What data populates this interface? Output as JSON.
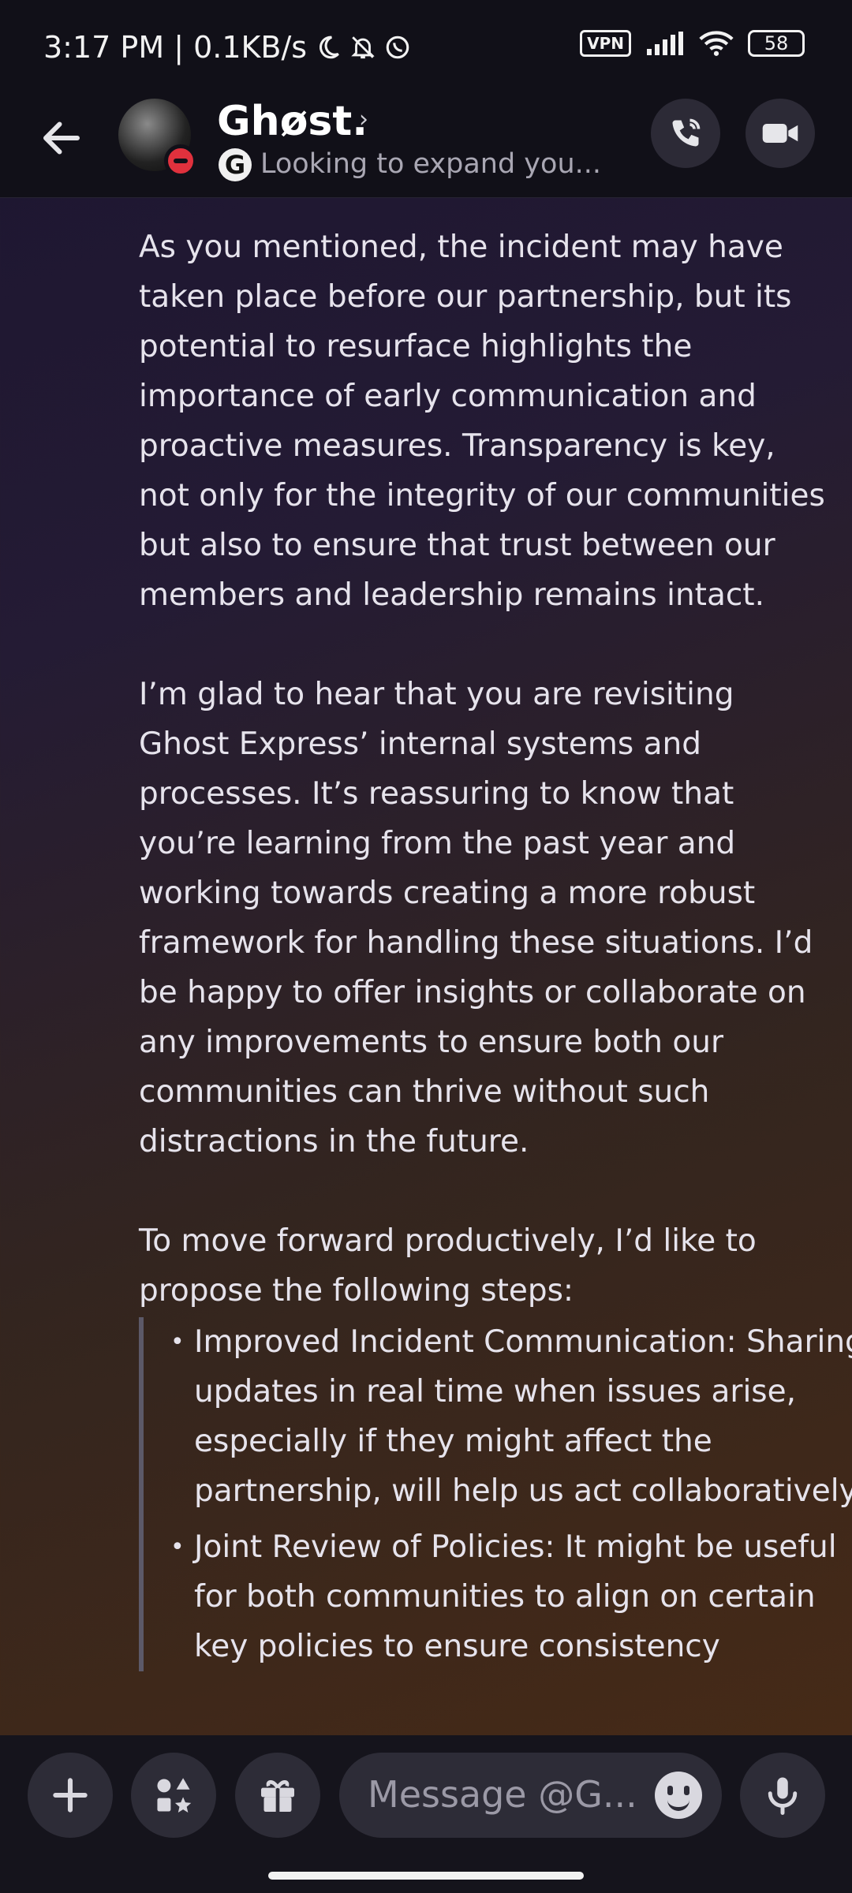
{
  "status_bar": {
    "time_net": "3:17 PM | 0.1KB/s",
    "vpn_label": "VPN",
    "battery": "58"
  },
  "header": {
    "name": "Ghøst.",
    "chevron": "›",
    "subtitle_icon": "G",
    "status_text": "Looking to expand you..."
  },
  "message": {
    "paragraphs": [
      "As you mentioned, the incident may have taken place before our partnership, but its potential to resurface highlights the importance of early communication and proactive measures. Transparency is key, not only for the integrity of our communities but also to ensure that trust between our members and leadership remains intact.",
      "I’m glad to hear that you are revisiting Ghost Express’ internal systems and processes. It’s reassuring to know that you’re learning from the past year and working towards creating a more robust framework for handling these situations. I’d be happy to offer insights or collaborate on any improvements to ensure both our communities can thrive without such distractions in the future.",
      "To move forward productively, I’d like to propose the following steps:"
    ],
    "bullets": [
      "Improved Incident Communication: Sharing updates in real time when issues arise, especially if they might affect the partnership, will help us act collaboratively.",
      "Joint Review of Policies: It might be useful for both communities to align on certain key policies to ensure consistency"
    ]
  },
  "composer": {
    "placeholder": "Message @G..."
  },
  "icons": [
    "back-arrow-icon",
    "avatar",
    "dnd-status-icon",
    "phone-icon",
    "video-icon",
    "plus-icon",
    "apps-icon",
    "gift-icon",
    "emoji-icon",
    "mic-icon"
  ]
}
